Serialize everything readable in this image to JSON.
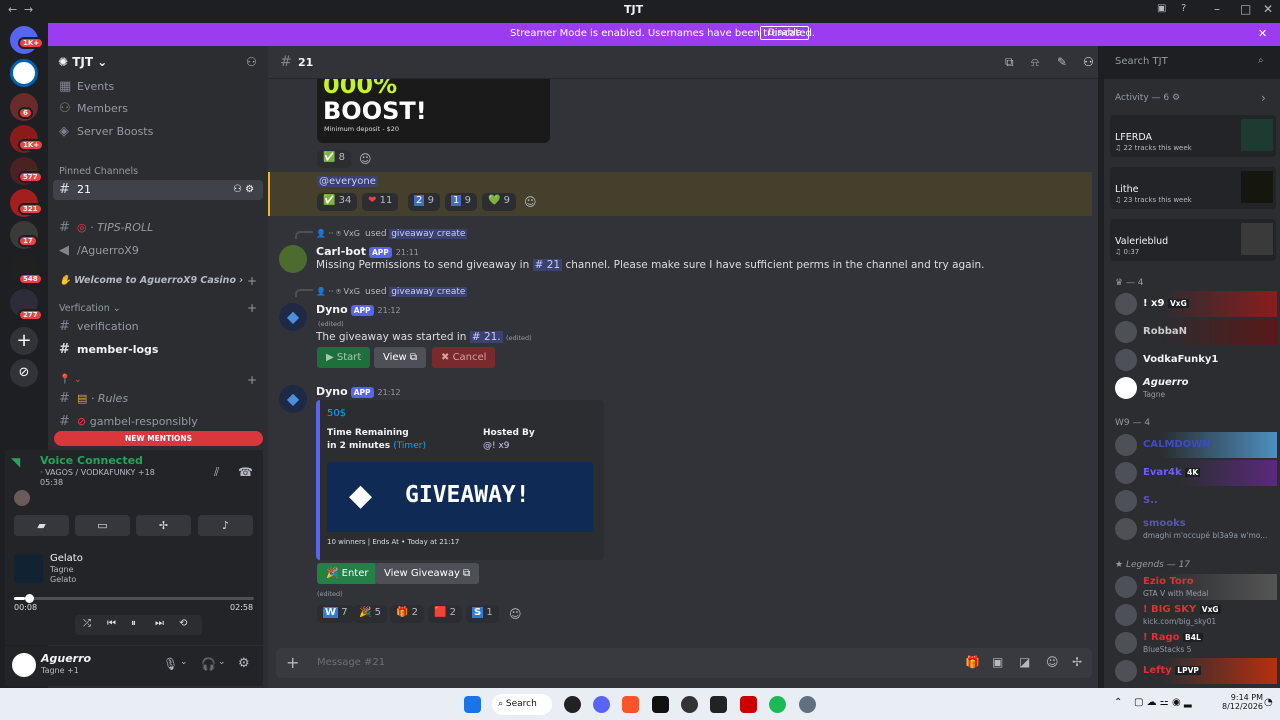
{
  "window": {
    "title": "TJT"
  },
  "banner": {
    "text": "Streamer Mode is enabled. Usernames have been truncated.",
    "button": "Disable"
  },
  "guild_badges": [
    "1K+",
    "6",
    "1K+",
    "577",
    "321",
    "17",
    "548",
    "277"
  ],
  "server": {
    "name": "TJT"
  },
  "sidebar": {
    "items": [
      {
        "label": "Events",
        "icon": "calendar-icon"
      },
      {
        "label": "Members",
        "icon": "members-icon"
      },
      {
        "label": "Server Boosts",
        "icon": "boost-icon"
      }
    ],
    "pinned_header": "Pinned Channels",
    "pinned_channel": "21",
    "channels": [
      "· TIPS-ROLL",
      "/AguerroX9"
    ],
    "category_casino": "Welcome to AguerroX9 Casino",
    "category_verification": "Verfication",
    "ver_channels": [
      "verification",
      "member-logs"
    ],
    "rules_channel": "· Rules",
    "gambel": "gambel-responsibly",
    "new_mentions": "NEW MENTIONS"
  },
  "voice": {
    "status": "Voice Connected",
    "channel": "· VAGOS / VODKAFUNKY +18",
    "timer": "05:38"
  },
  "music": {
    "title": "Gelato",
    "artist": "Tagne",
    "album": "Gelato",
    "elapsed": "00:08",
    "total": "02:58",
    "progress": 0.045
  },
  "user": {
    "name": "Aguerro",
    "status": "Tagne +1"
  },
  "channel": {
    "name": "21",
    "search_placeholder": "Search TJT",
    "composer_placeholder": "Message #21"
  },
  "chat": {
    "boost_img_text": "BOOST!",
    "boost_img_top": "000%",
    "boost_sub": "Minimum deposit - $20",
    "react1": [
      {
        "e": "✅",
        "n": "8"
      }
    ],
    "everyone": "@everyone",
    "react2": [
      {
        "e": "✅",
        "n": "34"
      },
      {
        "e": "❤",
        "n": "11"
      },
      {
        "e": "2",
        "n": "9"
      },
      {
        "e": "1",
        "n": "9"
      },
      {
        "e": "💚",
        "n": "9"
      }
    ],
    "m1": {
      "reply_user": "VxG",
      "reply_used": "used",
      "reply_cmd": "giveaway create",
      "author": "Carl-bot",
      "tag": "APP",
      "time": "21:11",
      "text": "Missing Permissions to send giveaway in",
      "chan": "21",
      "text2": "channel. Please make sure I have sufficient perms in the channel and try again."
    },
    "m2": {
      "reply_user": "VxG",
      "reply_used": "used",
      "reply_cmd": "giveaway create",
      "author": "Dyno",
      "tag": "APP",
      "time": "21:12",
      "edited_top": "(edited)",
      "text": "The giveaway was started in",
      "chan": "21.",
      "edited": "(edited)",
      "b_start": "Start",
      "b_view": "View",
      "b_cancel": "Cancel"
    },
    "m3": {
      "author": "Dyno",
      "tag": "APP",
      "time": "21:12",
      "embed_title": "50$",
      "f1_label": "Time Remaining",
      "f1_value": "in 2 minutes",
      "f1_timer": "(Timer)",
      "f2_label": "Hosted By",
      "f2_value": "@! x9",
      "giveaway_img": "GIVEAWAY!",
      "footer": "10 winners | Ends At • Today at 21:17",
      "b_enter": "Enter",
      "b_viewg": "View Giveaway",
      "edited": "(edited)"
    },
    "react3": [
      {
        "e": "W",
        "n": "7"
      },
      {
        "e": "🎉",
        "n": "5"
      },
      {
        "e": "🎁",
        "n": "2"
      },
      {
        "e": "🟥",
        "n": "2"
      },
      {
        "e": "S",
        "n": "1"
      }
    ]
  },
  "members": {
    "activity_header": "Activity — 6",
    "activity": [
      {
        "name": "LFERDA",
        "sub": "22 tracks this week"
      },
      {
        "name": "Lithe",
        "sub": "23 tracks this week"
      },
      {
        "name": "Valerieblud",
        "sub": "0:37"
      }
    ],
    "group1": "— 4",
    "g1": [
      {
        "name": "! x9",
        "tag": "VxG"
      },
      {
        "name": "RobbaN"
      },
      {
        "name": "VodkaFunky1"
      },
      {
        "name": "Aguerro",
        "sub": "Tagne"
      }
    ],
    "group2": "W9 — 4",
    "g2": [
      {
        "name": "CALMDOWN"
      },
      {
        "name": "Evar4k",
        "tag": "4K"
      },
      {
        "name": "S.."
      },
      {
        "name": "smooks",
        "sub": "dmaghi m'occupé bl3a9a w'mo..."
      }
    ],
    "group3": "Legends — 17",
    "g3": [
      {
        "name": "Ezio Toro",
        "sub": "GTA V with Medal"
      },
      {
        "name": "! BIG SKY",
        "tag": "VxG",
        "sub": "kick.com/big_sky01"
      },
      {
        "name": "! Rago",
        "tag": "B4L",
        "sub": "BlueStacks 5"
      },
      {
        "name": "Lefty",
        "tag": "LPVP"
      }
    ]
  },
  "taskbar": {
    "search": "Search",
    "time": "9:14 PM",
    "date": "8/12/2026"
  }
}
